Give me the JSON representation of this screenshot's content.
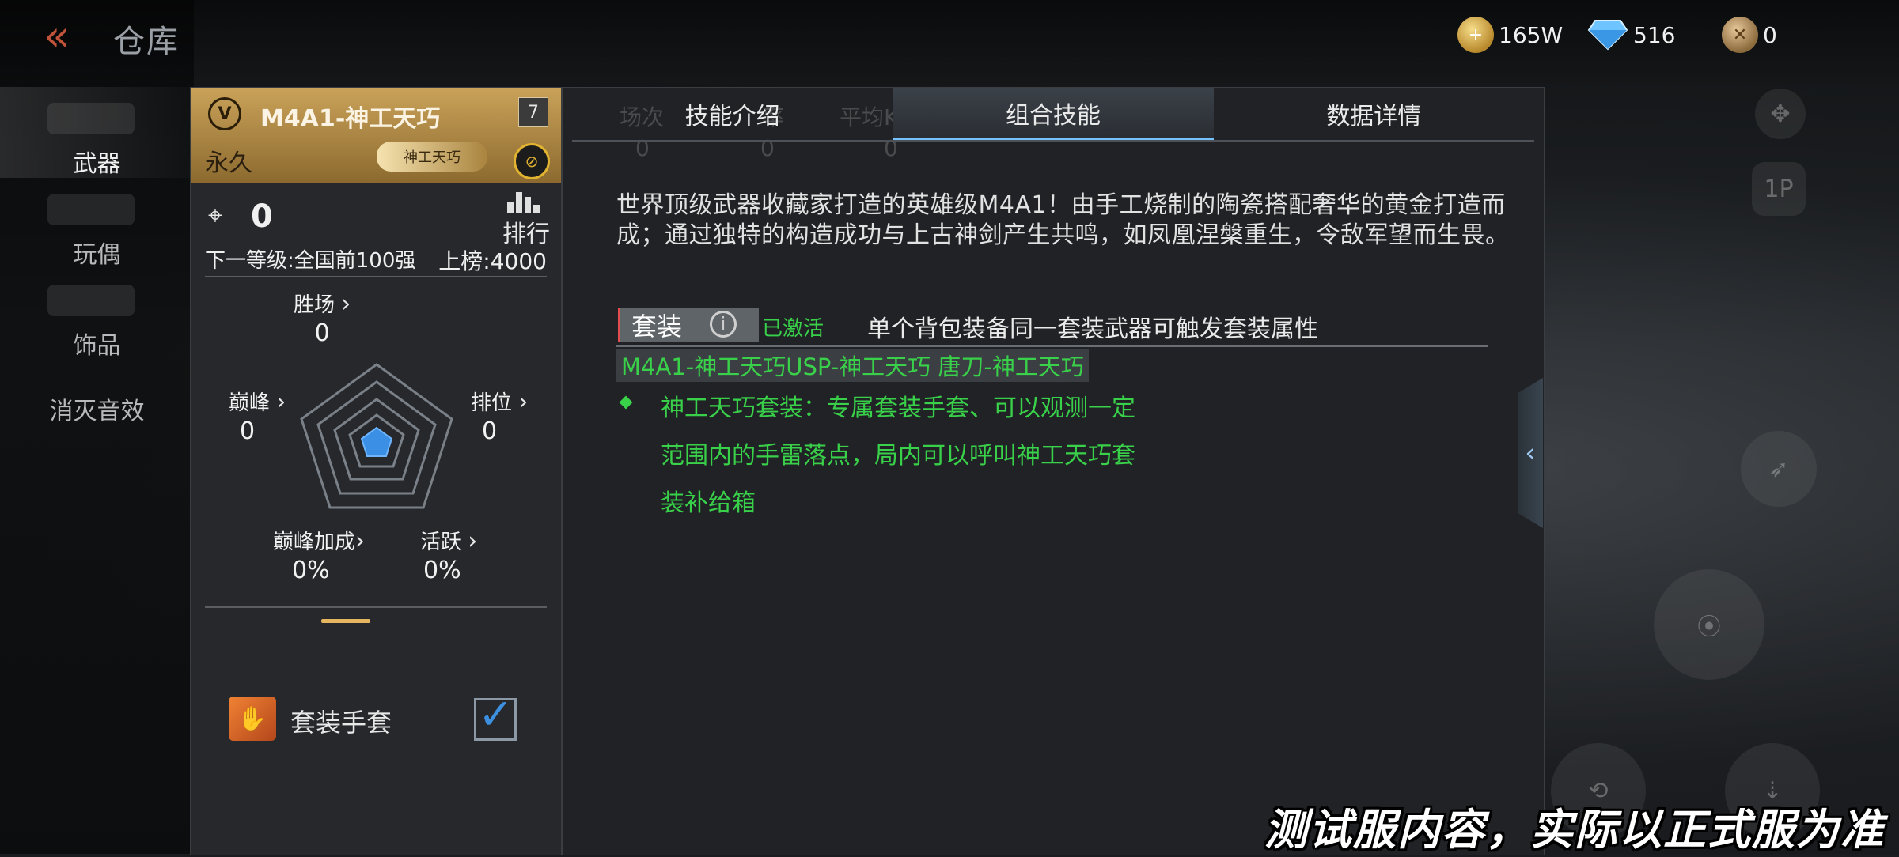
{
  "header": {
    "title": "仓库",
    "back_icon": "double-chevron-left-icon"
  },
  "resources": [
    {
      "icon": "gold-coin-icon",
      "value": "165W"
    },
    {
      "icon": "diamond-icon",
      "value": "516"
    },
    {
      "icon": "medal-icon",
      "value": "0"
    }
  ],
  "left_nav": [
    "武器",
    "玩偶",
    "饰品",
    "消灭音效"
  ],
  "weapon": {
    "tier_badge": "V",
    "name": "M4A1-神工天巧",
    "level": "7",
    "duration": "永久",
    "skin_badge": "神工天巧",
    "kills": "0",
    "rank_label": "排行",
    "next_level": "下一等级:全国前100强",
    "listing": "上榜:4000",
    "stats": {
      "wins": {
        "label": "胜场",
        "value": "0"
      },
      "peak": {
        "label": "巅峰",
        "value": "0"
      },
      "ranked": {
        "label": "排位",
        "value": "0"
      },
      "peak_bonus": {
        "label": "巅峰加成",
        "value": "0%"
      },
      "active": {
        "label": "活跃",
        "value": "0%"
      }
    }
  },
  "glove": {
    "label": "套装手套",
    "checked": true
  },
  "tabs": [
    "技能介绍",
    "组合技能",
    "数据详情"
  ],
  "active_tab": "组合技能",
  "ghost_headers": [
    "场次",
    "率",
    "平均KDA"
  ],
  "ghost_values": [
    "0",
    "0",
    "0"
  ],
  "description": "世界顶级武器收藏家打造的英雄级M4A1！由手工烧制的陶瓷搭配奢华的黄金打造而成；通过独特的构造成功与上古神剑产生共鸣，如凤凰涅槃重生，令敌军望而生畏。",
  "set": {
    "tag": "套装",
    "status": "已激活",
    "note": "单个背包装备同一套装武器可触发套装属性",
    "members": "M4A1-神工天巧USP-神工天巧 唐刀-神工天巧",
    "effect": "神工天巧套装：专属套装手套、可以观测一定范围内的手雷落点，局内可以呼叫神工天巧套装补给箱"
  },
  "background_buttons": [
    "1P"
  ],
  "disclaimer": "测试服内容，实际以正式服为准",
  "colors": {
    "accent_green": "#39d14a",
    "gold": "#caa259",
    "tab_highlight": "#76c2ff"
  }
}
